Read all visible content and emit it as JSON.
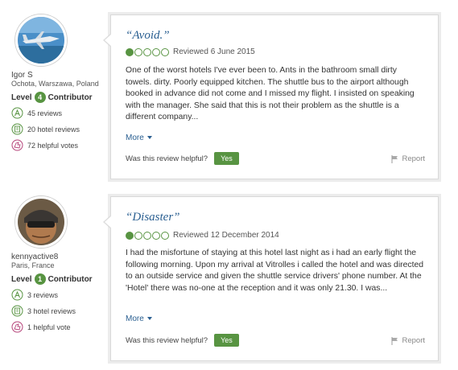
{
  "reviews": [
    {
      "user": {
        "name": "Igor S",
        "location": "Ochota, Warszawa, Poland",
        "level_label": "Level",
        "level": "4",
        "contributor_label": "Contributor",
        "reviews": "45 reviews",
        "hotel_reviews": "20 hotel reviews",
        "helpful_votes": "72 helpful votes"
      },
      "title": "“Avoid.”",
      "rating": 1,
      "date": "Reviewed 6 June 2015",
      "text": "One of the worst hotels I've ever been to. Ants in the bathroom small dirty towels. dirty. Poorly equipped kitchen. The shuttle bus to the airport although booked in advance did not come and I missed my flight. I insisted on speaking with the manager. She said that this is not their problem as the shuttle is a different company...",
      "more_label": "More",
      "helpful_label": "Was this review helpful?",
      "yes_label": "Yes",
      "report_label": "Report"
    },
    {
      "user": {
        "name": "kennyactive8",
        "location": "Paris, France",
        "level_label": "Level",
        "level": "1",
        "contributor_label": "Contributor",
        "reviews": "3 reviews",
        "hotel_reviews": "3 hotel reviews",
        "helpful_votes": "1 helpful vote"
      },
      "title": "“Disaster”",
      "rating": 1,
      "date": "Reviewed 12 December 2014",
      "text": "I had the misfortune of staying at this hotel last night as i had an early flight the following morning. Upon my arrival at Vitrolles i called the hotel and was directed to an outside service and given the shuttle service drivers' phone number. At the 'Hotel' there was no-one at the reception and it was only 21.30. I was...",
      "more_label": "More",
      "helpful_label": "Was this review helpful?",
      "yes_label": "Yes",
      "report_label": "Report"
    }
  ],
  "colors": {
    "brand_green": "#589442",
    "link_blue": "#2a5f91"
  },
  "icons": [
    "plane-avatar",
    "person-avatar",
    "pen-icon",
    "hotel-icon",
    "thumbs-icon",
    "flag-icon",
    "chevron-down-icon"
  ]
}
